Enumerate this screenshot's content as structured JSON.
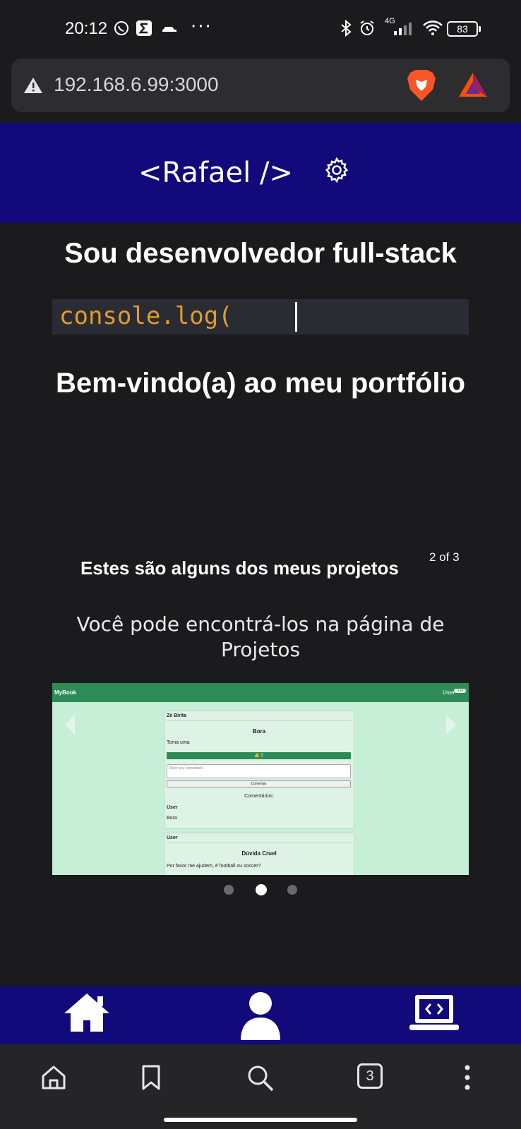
{
  "status_bar": {
    "time": "20:12",
    "battery": "83",
    "network": "4G",
    "more": "···"
  },
  "browser": {
    "url": "192.168.6.99:3000",
    "tab_count": "3"
  },
  "site": {
    "brand": "<Rafael />",
    "hero_title": "Sou desenvolvedor full-stack",
    "code_snippet": "console.log(",
    "welcome": "Bem-vindo(a) ao meu portfólio",
    "projects_heading": "Estes são alguns dos meus projetos",
    "carousel_counter": "2 of 3",
    "projects_subtext": "Você pode encontrá-los na página de Projetos"
  },
  "carousel_slide": {
    "app_name": "MyBook",
    "nav_user": "User",
    "nav_logout": "Sair",
    "post1": {
      "author": "Zé Birita",
      "title": "Bora",
      "body": "Toma uma",
      "likes": "👍 2",
      "comment_placeholder": "Deixe seu comentário",
      "comment_button": "Comentar",
      "comments_label": "Comentários:",
      "comment_user": "User",
      "comment_text": "Bora"
    },
    "post2": {
      "author": "User",
      "title": "Dúvida Cruel",
      "body": "Por favor me ajudem, é football ou soccer?"
    },
    "active_index": 1,
    "total": 3
  },
  "colors": {
    "header_bg": "#12097a",
    "page_bg": "#1b1b1d",
    "slide_bg": "#c7efd8",
    "slide_nav": "#2e8b57"
  }
}
